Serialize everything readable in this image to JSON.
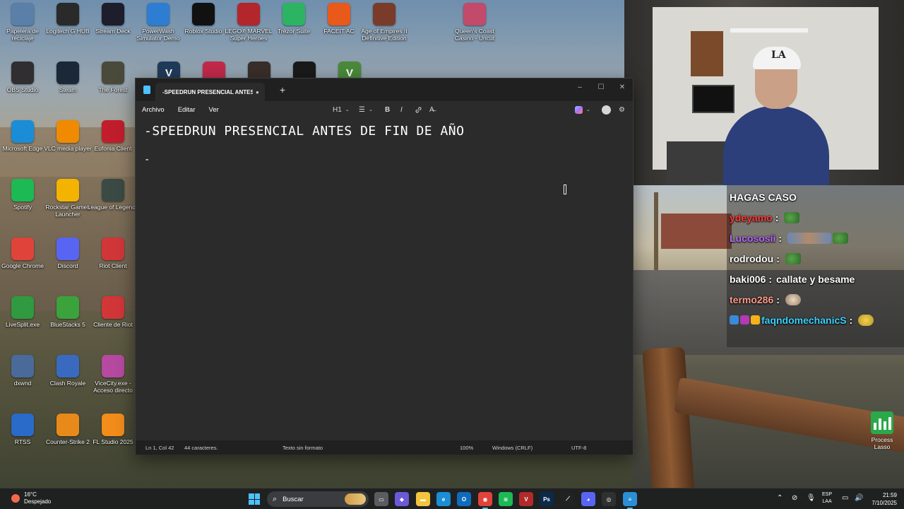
{
  "desktop": {
    "icons": [
      {
        "label": "Papelera de reciclaje",
        "icon": "recycle-bin-icon",
        "color": "#5a7fa8"
      },
      {
        "label": "Logitech G HUB",
        "icon": "logitech-icon",
        "color": "#2a2a2a"
      },
      {
        "label": "Stream Deck",
        "icon": "stream-deck-icon",
        "color": "#1d1d2b"
      },
      {
        "label": "PowerWash Simulator Demo",
        "icon": "powerwash-icon",
        "color": "#2d7dd2"
      },
      {
        "label": "Roblox Studio",
        "icon": "roblox-icon",
        "color": "#111111"
      },
      {
        "label": "LEGO® MARVEL Super Heroes",
        "icon": "lego-marvel-icon",
        "color": "#b3262c"
      },
      {
        "label": "Trezor Suite",
        "icon": "trezor-icon",
        "color": "#2cb463"
      },
      {
        "label": "FACEIT AC",
        "icon": "faceit-icon",
        "color": "#e8591a"
      },
      {
        "label": "Age of Empires II Definitive Edition",
        "icon": "age-of-empires-icon",
        "color": "#7a3b2a"
      },
      {
        "label": "Queen's Coast Casino - Uncut",
        "icon": "casino-icon",
        "color": "#c24a6a"
      },
      {
        "label": "OBS Studio",
        "icon": "obs-icon",
        "color": "#302e31"
      },
      {
        "label": "Steam",
        "icon": "steam-icon",
        "color": "#1b2838"
      },
      {
        "label": "The Forest",
        "icon": "the-forest-icon",
        "color": "#4a4a3a"
      },
      {
        "label": "Microsoft Edge",
        "icon": "edge-icon",
        "color": "#1a8dd6"
      },
      {
        "label": "VLC media player",
        "icon": "vlc-icon",
        "color": "#f08a00"
      },
      {
        "label": "Eufonia Client",
        "icon": "eufonia-icon",
        "color": "#c21d2c"
      },
      {
        "label": "Spotify",
        "icon": "spotify-icon",
        "color": "#1db954"
      },
      {
        "label": "Rockstar Games Launcher",
        "icon": "rockstar-icon",
        "color": "#f5b301"
      },
      {
        "label": "League of Legends",
        "icon": "league-icon",
        "color": "#3b4a44"
      },
      {
        "label": "Google Chrome",
        "icon": "chrome-icon",
        "color": "#e0433a"
      },
      {
        "label": "Discord",
        "icon": "discord-icon",
        "color": "#5865f2"
      },
      {
        "label": "Riot Client",
        "icon": "riot-client-icon",
        "color": "#d13639"
      },
      {
        "label": "LiveSplit.exe",
        "icon": "livesplit-icon",
        "color": "#2f9a3f"
      },
      {
        "label": "BlueStacks 5",
        "icon": "bluestacks-icon",
        "color": "#3ca23c"
      },
      {
        "label": "Cliente de Riot",
        "icon": "riot-client-icon",
        "color": "#d13639"
      },
      {
        "label": "dxwnd",
        "icon": "dxwnd-icon",
        "color": "#4a6a9a"
      },
      {
        "label": "Clash Royale",
        "icon": "clash-royale-icon",
        "color": "#3a6ac0"
      },
      {
        "label": "ViceCity.exe - Acceso directo",
        "icon": "vicecity-icon",
        "color": "#b54aa0"
      },
      {
        "label": "RTSS",
        "icon": "rtss-icon",
        "color": "#2a6ac8"
      },
      {
        "label": "Counter-Strike 2",
        "icon": "counter-strike-icon",
        "color": "#e88a1a"
      },
      {
        "label": "FL Studio 2025",
        "icon": "fl-studio-icon",
        "color": "#f28c1a"
      }
    ],
    "extra_icons": [
      {
        "icon": "vscode-like-icon",
        "color": "#1f3b5a",
        "glyph": "V"
      },
      {
        "icon": "game-icon-red",
        "color": "#c2294a",
        "glyph": ""
      },
      {
        "icon": "game-icon-dark",
        "color": "#3a2e2a",
        "glyph": ""
      },
      {
        "icon": "game-icon-orange",
        "color": "#1a1a1a",
        "glyph": ""
      },
      {
        "icon": "gta-v-icon",
        "color": "#4a8a3a",
        "glyph": "V"
      }
    ]
  },
  "notepad": {
    "tab_title": "-SPEEDRUN PRESENCIAL ANTES DI",
    "unsaved_dot": "●",
    "new_tab": "+",
    "win_minimize": "–",
    "win_maximize": "☐",
    "win_close": "✕",
    "menu": [
      "Archivo",
      "Editar",
      "Ver"
    ],
    "toolbar": {
      "heading": "H1",
      "list": "☰",
      "bold": "B",
      "italic": "I",
      "link": "🔗",
      "clear_format": "A̶"
    },
    "content": {
      "line1": "-SPEEDRUN PRESENCIAL ANTES DE FIN DE AÑO",
      "line2": "-"
    },
    "status": {
      "position": "Ln 1, Col 42",
      "chars": "44 caracteres.",
      "format": "Texto sin formato",
      "zoom": "100%",
      "line_ending": "Windows (CRLF)",
      "encoding": "UTF-8"
    }
  },
  "chat": {
    "header": "HAGAS CASO",
    "messages": [
      {
        "user": "ydeyamo",
        "color": "#ff3a3a",
        "text": "",
        "emotes": [
          "frog"
        ]
      },
      {
        "user": "Lucososii",
        "color": "#b86bff",
        "text": "",
        "emotes": [
          "wide",
          "frog"
        ]
      },
      {
        "user": "rodrodou",
        "color": "#ffffff",
        "text": "",
        "emotes": [
          "frog"
        ]
      },
      {
        "user": "baki006",
        "color": "#ffffff",
        "text": "callate y besame",
        "emotes": []
      },
      {
        "user": "termo286",
        "color": "#ff9a8a",
        "text": "",
        "emotes": [
          "cat"
        ]
      },
      {
        "user": "faqndomechanicS",
        "color": "#3ad1ff",
        "text": "",
        "emotes": [
          "yellow"
        ],
        "badges": true
      }
    ]
  },
  "process_lasso": {
    "label": "Process Lasso"
  },
  "taskbar": {
    "weather_temp": "16°C",
    "weather_desc": "Despejado",
    "search_label": "Buscar",
    "lang_top": "ESP",
    "lang_bottom": "LAA",
    "time": "21:59",
    "date": "7/10/2025",
    "apps": [
      {
        "icon": "task-view-icon",
        "color": "#5a5c60",
        "glyph": "▭"
      },
      {
        "icon": "copilot-icon",
        "color": "#6a5ad8",
        "glyph": "◆"
      },
      {
        "icon": "file-explorer-icon",
        "color": "#f2c53d",
        "glyph": "▬"
      },
      {
        "icon": "edge-icon",
        "color": "#1a8dd6",
        "glyph": "e"
      },
      {
        "icon": "outlook-icon",
        "color": "#0f6cbd",
        "glyph": "O"
      },
      {
        "icon": "chrome-icon",
        "color": "#e0433a",
        "glyph": "◉",
        "active": true
      },
      {
        "icon": "spotify-icon",
        "color": "#1db954",
        "glyph": "≋"
      },
      {
        "icon": "voicemeeter-icon",
        "color": "#b22a2a",
        "glyph": "V"
      },
      {
        "icon": "photoshop-icon",
        "color": "#0b2a4a",
        "glyph": "Ps"
      },
      {
        "icon": "livesplit-taskbar-icon",
        "color": "#222222",
        "glyph": "⟋"
      },
      {
        "icon": "discord-icon",
        "color": "#5865f2",
        "glyph": "◕"
      },
      {
        "icon": "obs-taskbar-icon",
        "color": "#303030",
        "glyph": "◎"
      },
      {
        "icon": "notepad-icon",
        "color": "#2b8fd6",
        "glyph": "≡",
        "active": true
      }
    ]
  }
}
